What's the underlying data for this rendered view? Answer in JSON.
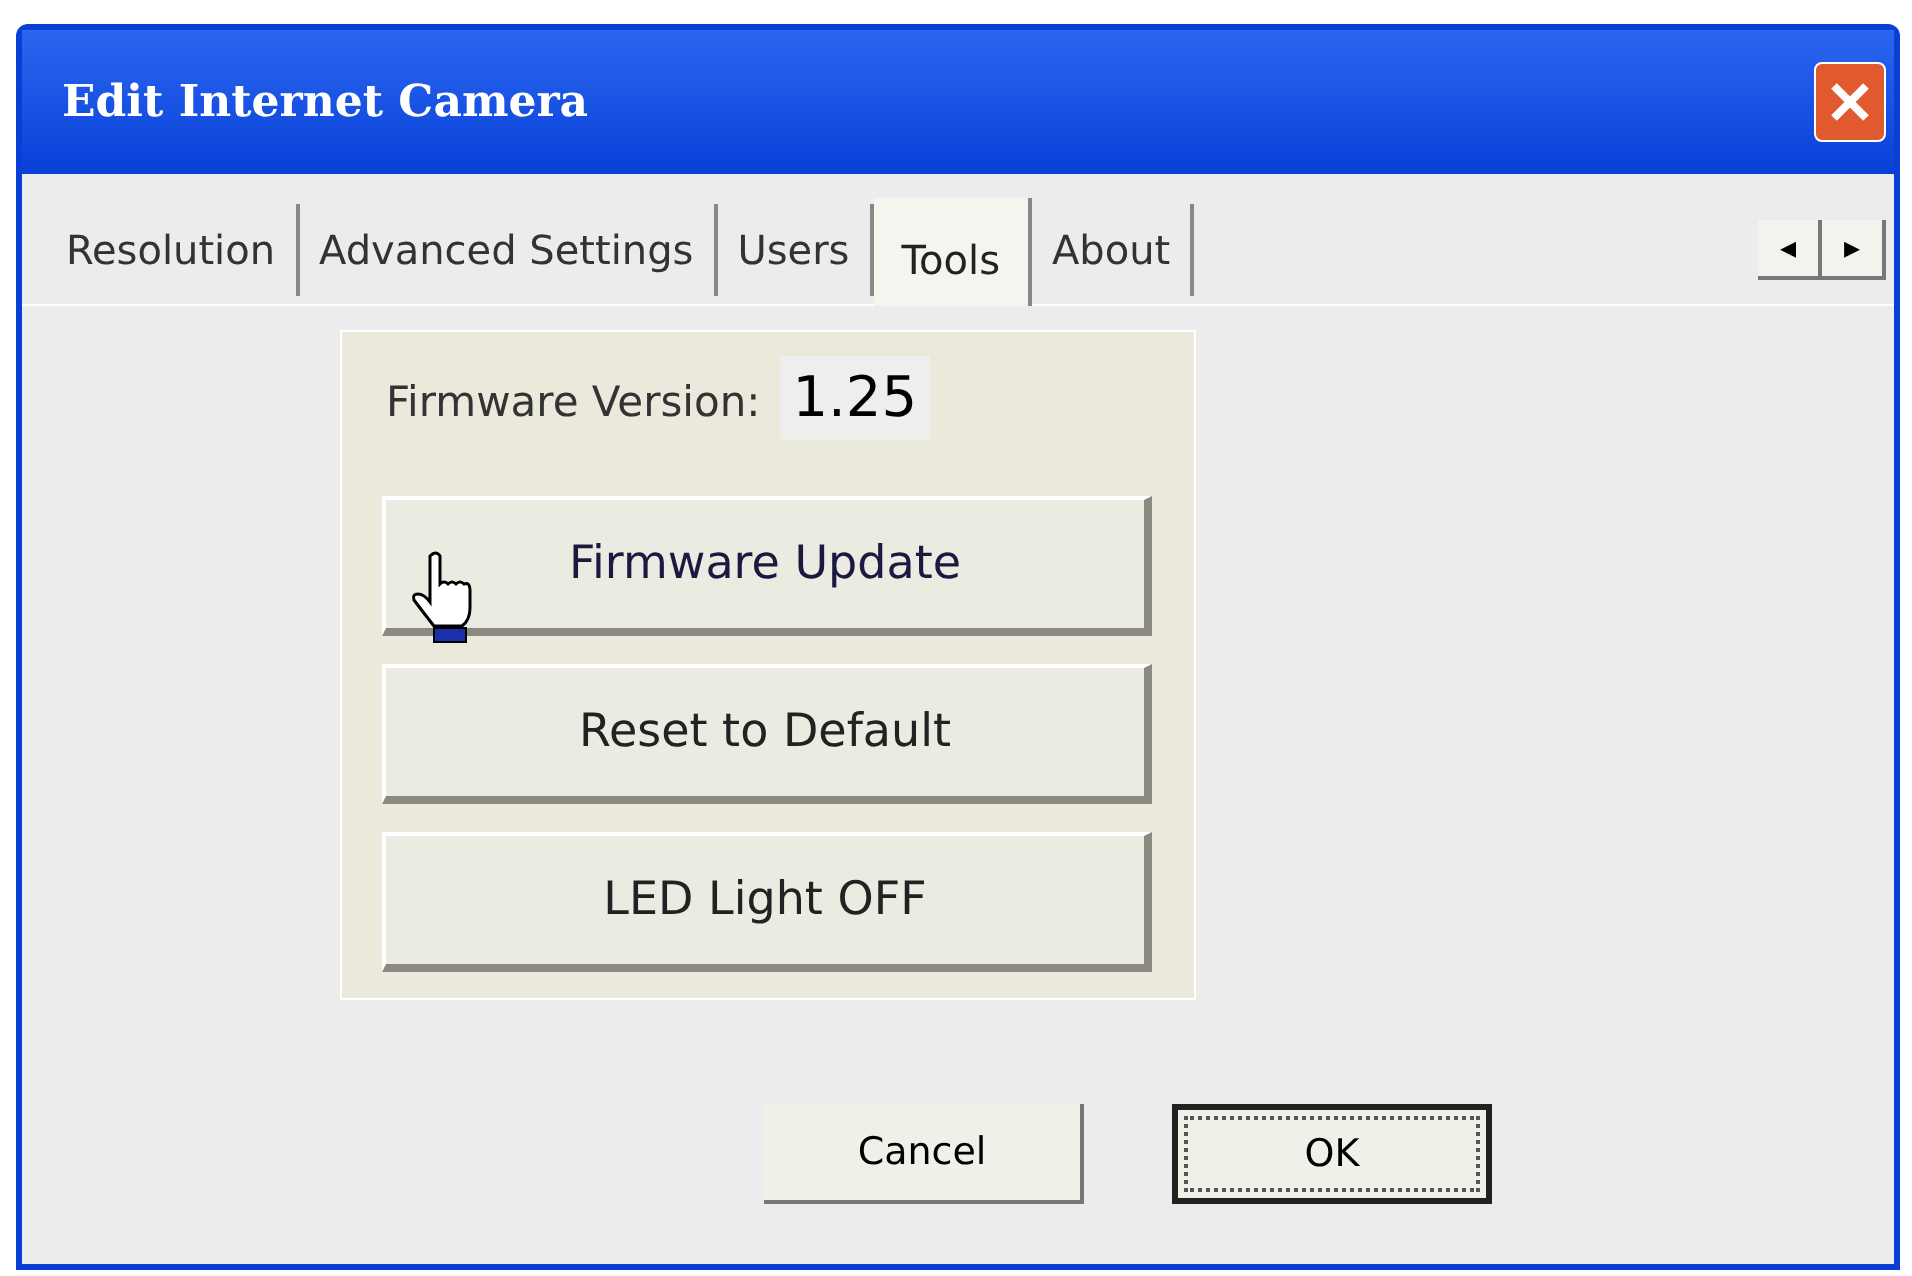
{
  "window": {
    "title": "Edit Internet Camera"
  },
  "tabs": [
    {
      "label": "Resolution",
      "selected": false
    },
    {
      "label": "Advanced Settings",
      "selected": false
    },
    {
      "label": "Users",
      "selected": false
    },
    {
      "label": "Tools",
      "selected": true
    },
    {
      "label": "About",
      "selected": false
    }
  ],
  "tab_scroll": [
    "◂",
    "▸"
  ],
  "tools_panel": {
    "firmware_label": "Firmware Version:",
    "firmware_value": "1.25",
    "buttons": [
      {
        "label": "Firmware Update",
        "hovered": true
      },
      {
        "label": "Reset to Default",
        "hovered": false
      },
      {
        "label": "LED Light OFF",
        "hovered": false
      }
    ]
  },
  "dialog_buttons": [
    {
      "label": "Cancel",
      "default": false
    },
    {
      "label": "OK",
      "default": true
    }
  ]
}
